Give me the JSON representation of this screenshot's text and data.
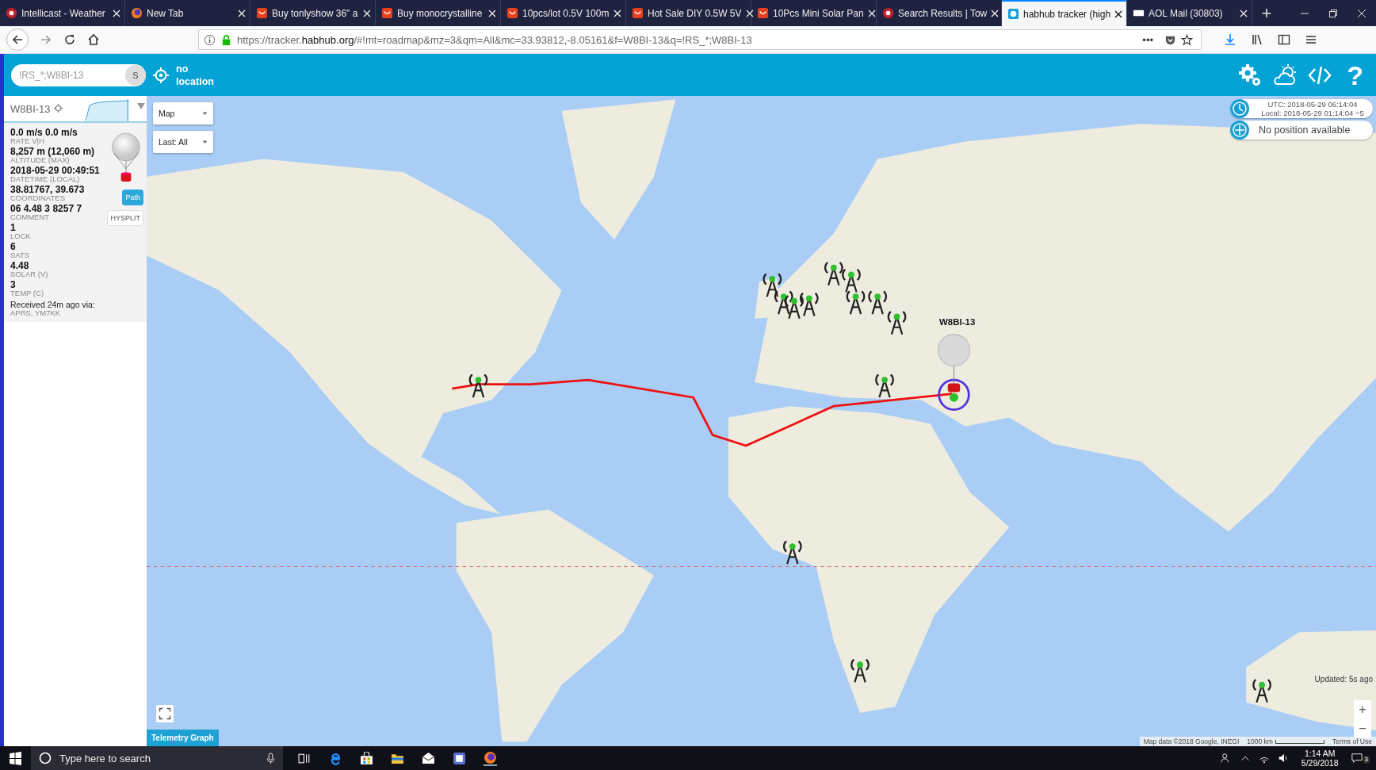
{
  "tabs": [
    {
      "title": "Intellicast - Weather",
      "selected": false
    },
    {
      "title": "New Tab",
      "selected": false
    },
    {
      "title": "Buy tonlyshow 36\" a",
      "selected": false
    },
    {
      "title": "Buy monocrystalline",
      "selected": false
    },
    {
      "title": "10pcs/lot 0.5V 100m",
      "selected": false
    },
    {
      "title": "Hot Sale DIY 0.5W 5V",
      "selected": false
    },
    {
      "title": "10Pcs Mini Solar Pan",
      "selected": false
    },
    {
      "title": "Search Results | Tow",
      "selected": false
    },
    {
      "title": "habhub tracker (high",
      "selected": true
    },
    {
      "title": "AOL Mail (30803)",
      "selected": false
    }
  ],
  "new_tab_glyph": "+",
  "address": {
    "scheme": "https://tracker.",
    "domain": "habhub.org",
    "path": "/#!mt=roadmap&mz=3&qm=All&mc=33.93812,-8.05161&f=W8BI-13&q=!RS_*;W8BI-13",
    "more": "•••"
  },
  "header": {
    "search_value": "!RS_*;W8BI-13",
    "search_button": "S",
    "location": "no location",
    "help_glyph": "?"
  },
  "panel": {
    "callsign": "W8BI-13",
    "fields": [
      {
        "value": "0.0 m/s 0.0 m/s",
        "label": "RATE V|H"
      },
      {
        "value": "8,257 m (12,060 m)",
        "label": "ALTITUDE (MAX)"
      },
      {
        "value": "2018-05-29 00:49:51",
        "label": "DATETIME (LOCAL)"
      },
      {
        "value": "38.81767, 39.673",
        "label": "COORDINATES"
      },
      {
        "value": "06 4.48 3 8257 7",
        "label": "COMMENT"
      },
      {
        "value": "1",
        "label": "LOCK"
      },
      {
        "value": "6",
        "label": "SATS"
      },
      {
        "value": "4.48",
        "label": "SOLAR (V)"
      },
      {
        "value": "3",
        "label": "TEMP (C)"
      }
    ],
    "buttons": [
      {
        "label": "Path",
        "selected": true
      },
      {
        "label": "HYSPLIT",
        "selected": false
      }
    ],
    "received": "Received 24m ago via:",
    "via": "APRS, YM7KK"
  },
  "map": {
    "type_select": "Map",
    "period_select": "Last: All",
    "utc": "UTC: 2018-05-29 06:14:04",
    "local": "Local: 2018-05-29 01:14:04 −5",
    "position": "No position available",
    "marker_label": "W8BI-13",
    "telemetry_button": "Telemetry Graph",
    "updated": "Updated: 5s ago",
    "zoom_in": "+",
    "zoom_out": "−",
    "attribution": "Map data ©2018 Google, INEGI",
    "scale": "1000 km",
    "terms": "Terms of Use"
  },
  "taskbar": {
    "search_placeholder": "Type here to search",
    "time": "1:14 AM",
    "date": "5/29/2018",
    "notifications": "3"
  }
}
